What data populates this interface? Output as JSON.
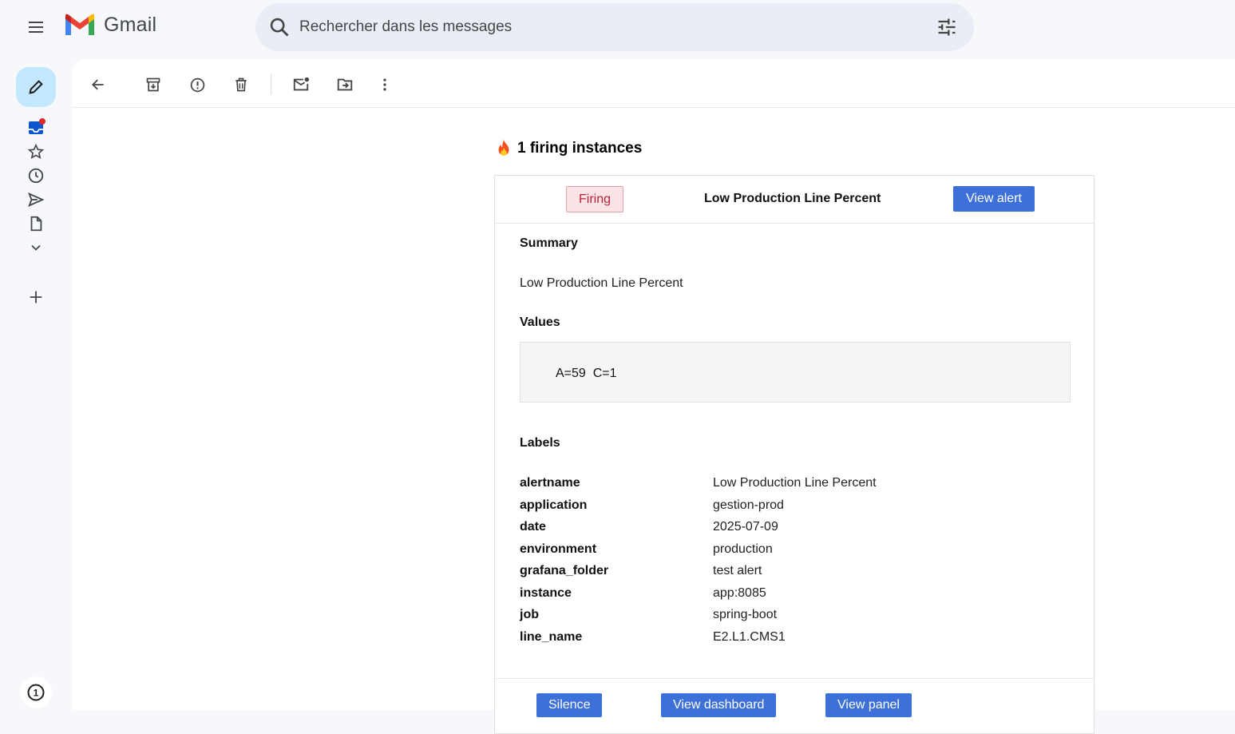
{
  "app": {
    "name": "Gmail"
  },
  "search": {
    "placeholder": "Rechercher dans les messages"
  },
  "mail": {
    "heading": "1 firing instances",
    "status_badge": "Firing",
    "alert_title": "Low Production Line Percent",
    "view_alert_label": "View alert",
    "summary_heading": "Summary",
    "summary_text": "Low Production Line Percent",
    "values_heading": "Values",
    "values_text": "A=59  C=1",
    "labels_heading": "Labels",
    "labels": [
      {
        "key": "alertname",
        "value": "Low Production Line Percent"
      },
      {
        "key": "application",
        "value": "gestion-prod"
      },
      {
        "key": "date",
        "value": "2025-07-09"
      },
      {
        "key": "environment",
        "value": "production"
      },
      {
        "key": "grafana_folder",
        "value": "test alert"
      },
      {
        "key": "instance",
        "value": "app:8085"
      },
      {
        "key": "job",
        "value": "spring-boot"
      },
      {
        "key": "line_name",
        "value": "E2.L1.CMS1"
      }
    ],
    "footer_buttons": [
      "Silence",
      "View dashboard",
      "View panel"
    ]
  },
  "rail": {
    "bottom_badge": "1"
  },
  "colors": {
    "accent": "#3d71d9",
    "compose_bg": "#c2e7ff",
    "firing_bg": "#fbe3e6",
    "firing_text": "#b4243a",
    "unread_dot": "#e02a2a"
  },
  "icons": {
    "toolbar": [
      "back-arrow-icon",
      "archive-icon",
      "report-spam-icon",
      "delete-icon",
      "mark-unread-icon",
      "move-to-icon",
      "more-vertical-icon"
    ],
    "rail": [
      "pencil-icon",
      "inbox-icon",
      "star-icon",
      "clock-icon",
      "send-icon",
      "draft-icon",
      "chevron-down-icon",
      "plus-icon"
    ]
  }
}
